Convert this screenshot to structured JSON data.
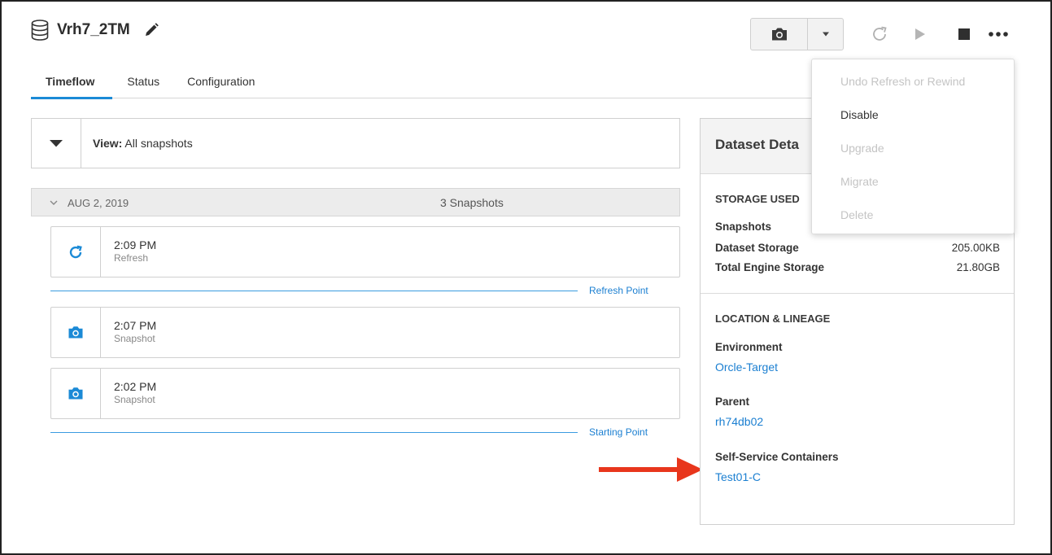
{
  "header": {
    "title": "Vrh7_2TM"
  },
  "tabs": [
    {
      "label": "Timeflow",
      "active": true
    },
    {
      "label": "Status",
      "active": false
    },
    {
      "label": "Configuration",
      "active": false
    }
  ],
  "menu": {
    "items": [
      {
        "label": "Undo Refresh or Rewind",
        "enabled": false
      },
      {
        "label": "Disable",
        "enabled": true
      },
      {
        "label": "Upgrade",
        "enabled": false
      },
      {
        "label": "Migrate",
        "enabled": false
      },
      {
        "label": "Delete",
        "enabled": false
      }
    ]
  },
  "view": {
    "prefix": "View:",
    "value": " All snapshots"
  },
  "group": {
    "date": "AUG 2, 2019",
    "count": "3 Snapshots"
  },
  "snapshots": [
    {
      "time": "2:09 PM",
      "type": "Refresh",
      "icon": "refresh-icon"
    },
    {
      "time": "2:07 PM",
      "type": "Snapshot",
      "icon": "camera-icon"
    },
    {
      "time": "2:02 PM",
      "type": "Snapshot",
      "icon": "camera-icon"
    }
  ],
  "points": {
    "refresh": "Refresh Point",
    "starting": "Starting Point"
  },
  "details": {
    "title": "Dataset Deta",
    "storage_title": "STORAGE USED",
    "storage": [
      {
        "key": "Snapshots",
        "value": ""
      },
      {
        "key": "Dataset Storage",
        "value": "205.00KB"
      },
      {
        "key": "Total Engine Storage",
        "value": "21.80GB"
      }
    ],
    "lineage_title": "LOCATION & LINEAGE",
    "environment_label": "Environment",
    "environment_value": "Orcle-Target",
    "parent_label": "Parent",
    "parent_value": "rh74db02",
    "ssc_label": "Self-Service Containers",
    "ssc_value": "Test01-C"
  },
  "colors": {
    "accent": "#1b8ad6",
    "link": "#1b7fd1",
    "annotation_arrow": "#e8361c"
  }
}
